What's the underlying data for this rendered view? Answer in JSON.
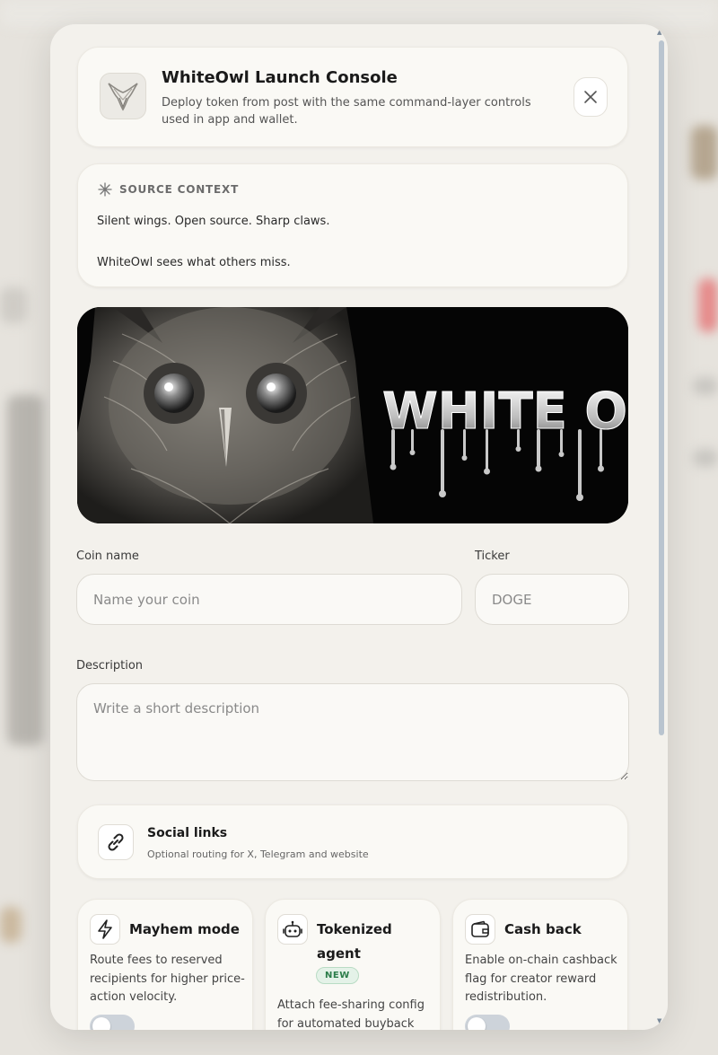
{
  "header": {
    "title": "WhiteOwl Launch Console",
    "subtitle": "Deploy token from post with the same command-layer controls used in app and wallet."
  },
  "source": {
    "heading": "SOURCE CONTEXT",
    "line1": "Silent wings. Open source. Sharp claws.",
    "line2": "WhiteOwl sees what others miss."
  },
  "banner": {
    "text": "WHITE OWL"
  },
  "form": {
    "coin_name_label": "Coin name",
    "coin_name_placeholder": "Name your coin",
    "coin_name_value": "",
    "ticker_label": "Ticker",
    "ticker_placeholder": "DOGE",
    "ticker_value": "",
    "description_label": "Description",
    "description_placeholder": "Write a short description",
    "description_value": ""
  },
  "social": {
    "title": "Social links",
    "subtitle": "Optional routing for X, Telegram and website"
  },
  "features": [
    {
      "title": "Mayhem mode",
      "description": "Route fees to reserved recipients for higher price-action velocity.",
      "enabled": false,
      "icon": "lightning-icon"
    },
    {
      "title": "Tokenized agent",
      "badge": "NEW",
      "description": "Attach fee-sharing config for automated buyback",
      "enabled": false,
      "icon": "robot-icon"
    },
    {
      "title": "Cash back",
      "description": "Enable on-chain cashback flag for creator reward redistribution.",
      "enabled": false,
      "icon": "wallet-icon"
    }
  ],
  "colors": {
    "modal_bg": "#f3f1ec",
    "card_bg": "#faf9f5",
    "badge_green": "#2c7d4a",
    "toggle_off": "#cdd3da"
  }
}
